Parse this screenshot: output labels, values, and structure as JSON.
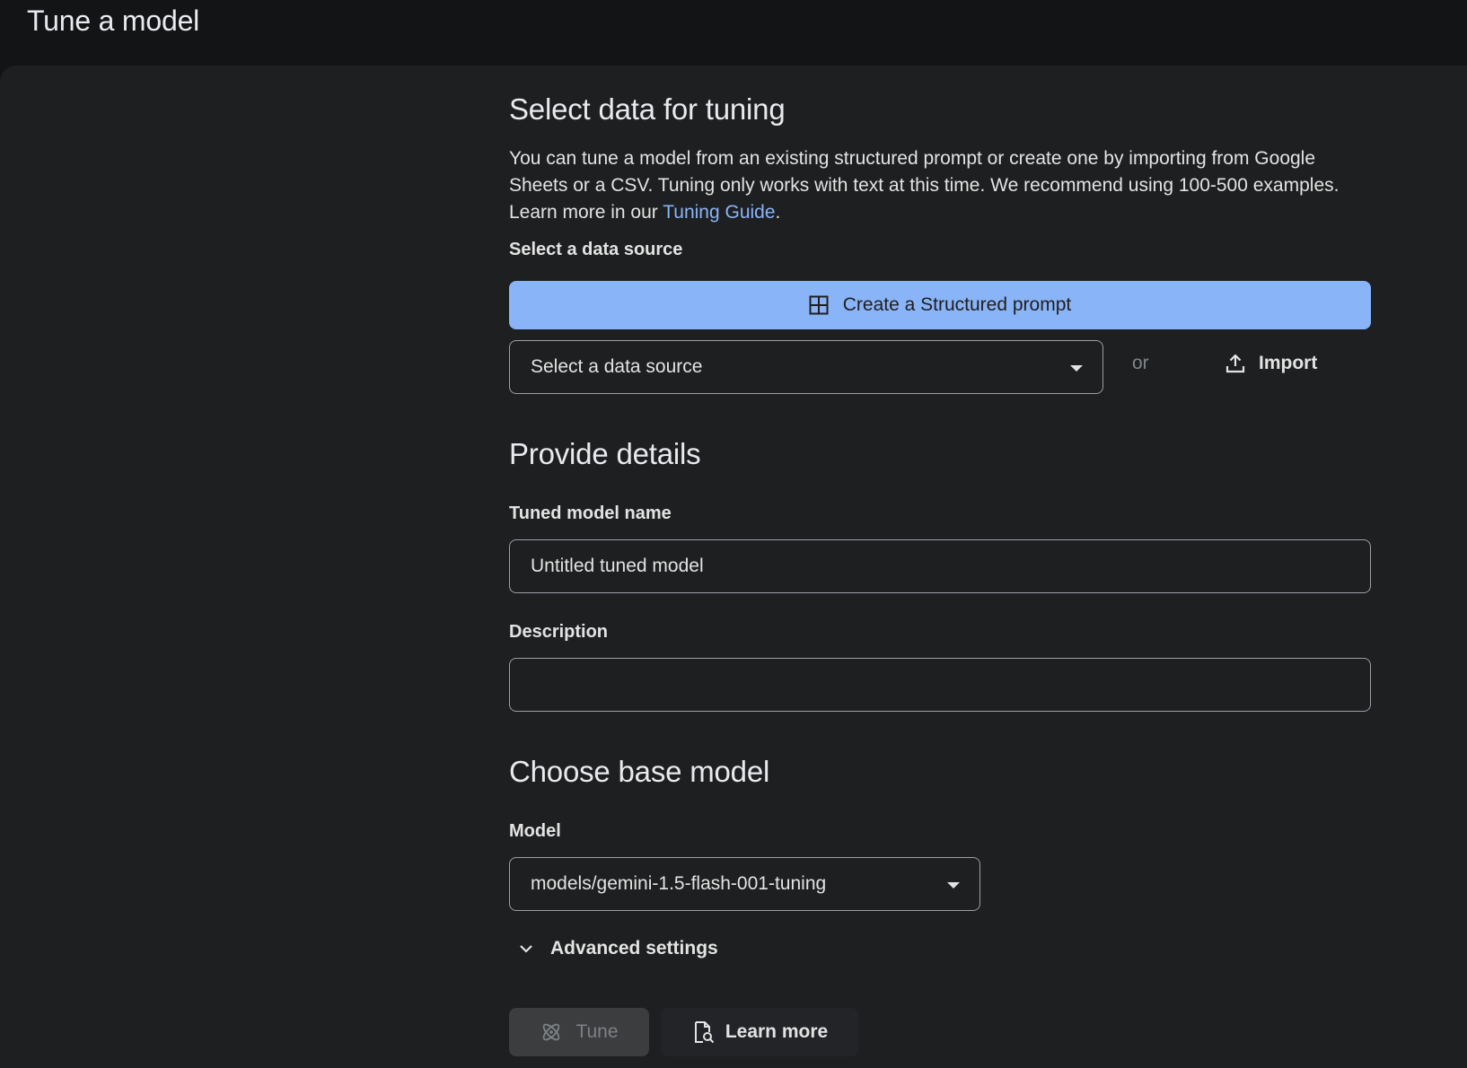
{
  "header": {
    "title": "Tune a model"
  },
  "section_data": {
    "heading": "Select data for tuning",
    "description_text": "You can tune a model from an existing structured prompt or create one by importing from Google Sheets or a CSV. Tuning only works with text at this time. We recommend using 100-500 examples. Learn more in our ",
    "link_text": "Tuning Guide",
    "description_end": ".",
    "source_label": "Select a data source",
    "create_button_label": "Create a Structured prompt",
    "source_select_value": "Select a data source",
    "or_text": "or",
    "import_label": "Import"
  },
  "section_details": {
    "heading": "Provide details",
    "name_label": "Tuned model name",
    "name_value": "Untitled tuned model",
    "description_label": "Description",
    "description_value": ""
  },
  "section_model": {
    "heading": "Choose base model",
    "model_label": "Model",
    "model_value": "models/gemini-1.5-flash-001-tuning",
    "advanced_label": "Advanced settings"
  },
  "actions": {
    "tune_label": "Tune",
    "learn_more_label": "Learn more"
  },
  "colors": {
    "accent": "#8ab4f8",
    "background": "#1e1f20",
    "topbar": "#131416"
  }
}
